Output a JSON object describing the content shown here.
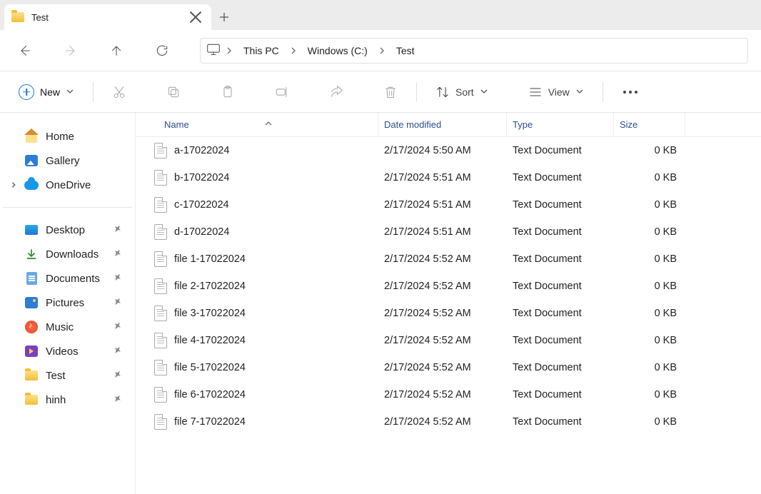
{
  "tab": {
    "title": "Test"
  },
  "breadcrumb": {
    "segments": [
      "This PC",
      "Windows (C:)",
      "Test"
    ]
  },
  "toolbar": {
    "new_label": "New",
    "sort_label": "Sort",
    "view_label": "View"
  },
  "sidebar": {
    "top": [
      {
        "label": "Home",
        "icon": "home"
      },
      {
        "label": "Gallery",
        "icon": "gallery"
      },
      {
        "label": "OneDrive",
        "icon": "cloud",
        "caret": true
      }
    ],
    "pinned": [
      {
        "label": "Desktop",
        "icon": "desktop"
      },
      {
        "label": "Downloads",
        "icon": "download"
      },
      {
        "label": "Documents",
        "icon": "doc"
      },
      {
        "label": "Pictures",
        "icon": "pic"
      },
      {
        "label": "Music",
        "icon": "music"
      },
      {
        "label": "Videos",
        "icon": "video"
      },
      {
        "label": "Test",
        "icon": "folder"
      },
      {
        "label": "hinh",
        "icon": "folder"
      }
    ]
  },
  "columns": {
    "name": "Name",
    "date": "Date modified",
    "type": "Type",
    "size": "Size"
  },
  "files": [
    {
      "name": "a-17022024",
      "date": "2/17/2024 5:50 AM",
      "type": "Text Document",
      "size": "0 KB"
    },
    {
      "name": "b-17022024",
      "date": "2/17/2024 5:51 AM",
      "type": "Text Document",
      "size": "0 KB"
    },
    {
      "name": "c-17022024",
      "date": "2/17/2024 5:51 AM",
      "type": "Text Document",
      "size": "0 KB"
    },
    {
      "name": "d-17022024",
      "date": "2/17/2024 5:51 AM",
      "type": "Text Document",
      "size": "0 KB"
    },
    {
      "name": "file 1-17022024",
      "date": "2/17/2024 5:52 AM",
      "type": "Text Document",
      "size": "0 KB"
    },
    {
      "name": "file 2-17022024",
      "date": "2/17/2024 5:52 AM",
      "type": "Text Document",
      "size": "0 KB"
    },
    {
      "name": "file 3-17022024",
      "date": "2/17/2024 5:52 AM",
      "type": "Text Document",
      "size": "0 KB"
    },
    {
      "name": "file 4-17022024",
      "date": "2/17/2024 5:52 AM",
      "type": "Text Document",
      "size": "0 KB"
    },
    {
      "name": "file 5-17022024",
      "date": "2/17/2024 5:52 AM",
      "type": "Text Document",
      "size": "0 KB"
    },
    {
      "name": "file 6-17022024",
      "date": "2/17/2024 5:52 AM",
      "type": "Text Document",
      "size": "0 KB"
    },
    {
      "name": "file 7-17022024",
      "date": "2/17/2024 5:52 AM",
      "type": "Text Document",
      "size": "0 KB"
    }
  ]
}
